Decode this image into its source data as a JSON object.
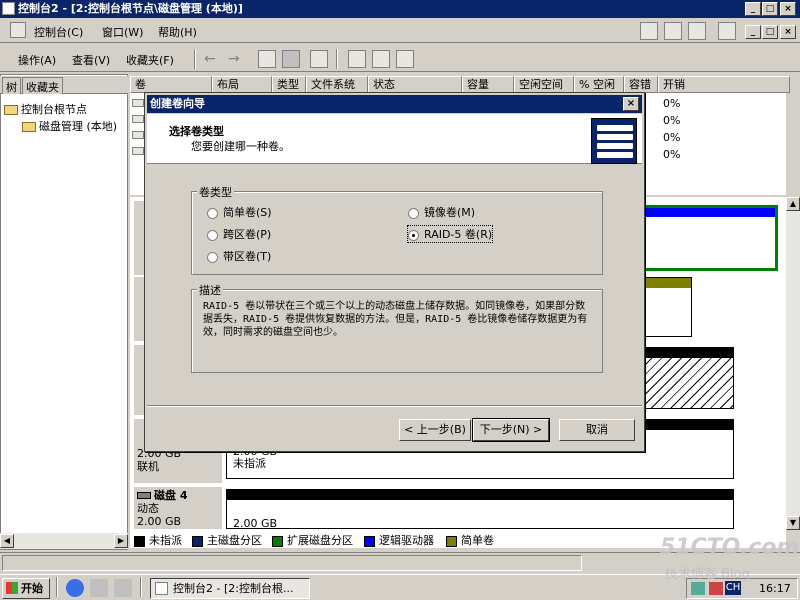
{
  "window": {
    "title": "控制台2 - [2:控制台根节点\\磁盘管理 (本地)]"
  },
  "menubar": {
    "console": "控制台(C)",
    "window": "窗口(W)",
    "help": "帮助(H)"
  },
  "toolbar": {
    "action": "操作(A)",
    "view": "查看(V)",
    "favorites": "收藏夹(F)"
  },
  "leftpane": {
    "tabs": [
      "树",
      "收藏夹"
    ],
    "tree": [
      "控制台根节点",
      "磁盘管理 (本地)"
    ]
  },
  "columns": [
    "卷",
    "布局",
    "类型",
    "文件系统",
    "状态",
    "容量",
    "空闲空间",
    "% 空闲",
    "容错",
    "开销"
  ],
  "list_overhead": [
    "0%",
    "0%",
    "0%",
    "0%"
  ],
  "disks": [
    {
      "size": "2.00 GB",
      "status": "联机",
      "vol_size": "2.00 GB",
      "vol_state": "未指派"
    },
    {
      "name": "磁盘 4",
      "type": "动态",
      "size": "2.00 GB",
      "vol_size": "2.00 GB"
    }
  ],
  "legend": [
    "未指派",
    "主磁盘分区",
    "扩展磁盘分区",
    "逻辑驱动器",
    "简单卷"
  ],
  "legend_colors": [
    "#000000",
    "#0a246a",
    "#008000",
    "#0000ff",
    "#808000"
  ],
  "dialog": {
    "title": "创建卷向导",
    "heading": "选择卷类型",
    "subheading": "您要创建哪一种卷。",
    "group_label": "卷类型",
    "options": [
      "简单卷(S)",
      "跨区卷(P)",
      "带区卷(T)",
      "镜像卷(M)",
      "RAID-5 卷(R)"
    ],
    "selected": "RAID-5 卷(R)",
    "desc_label": "描述",
    "description": "RAID-5 卷以带状在三个或三个以上的动态磁盘上储存数据。如同镜像卷，如果部分数据丢失，RAID-5 卷提供恢复数据的方法。但是，RAID-5 卷比镜像卷储存数据更为有效，同时需求的磁盘空间也少。",
    "back": "< 上一步(B)",
    "next": "下一步(N) >",
    "cancel": "取消"
  },
  "taskbar": {
    "start": "开始",
    "task": "控制台2 - [2:控制台根...",
    "tray_lang": "CH",
    "clock": "16:17"
  },
  "watermark": {
    "line1": "51CTO.com",
    "line2": "技术博客 Blog"
  }
}
